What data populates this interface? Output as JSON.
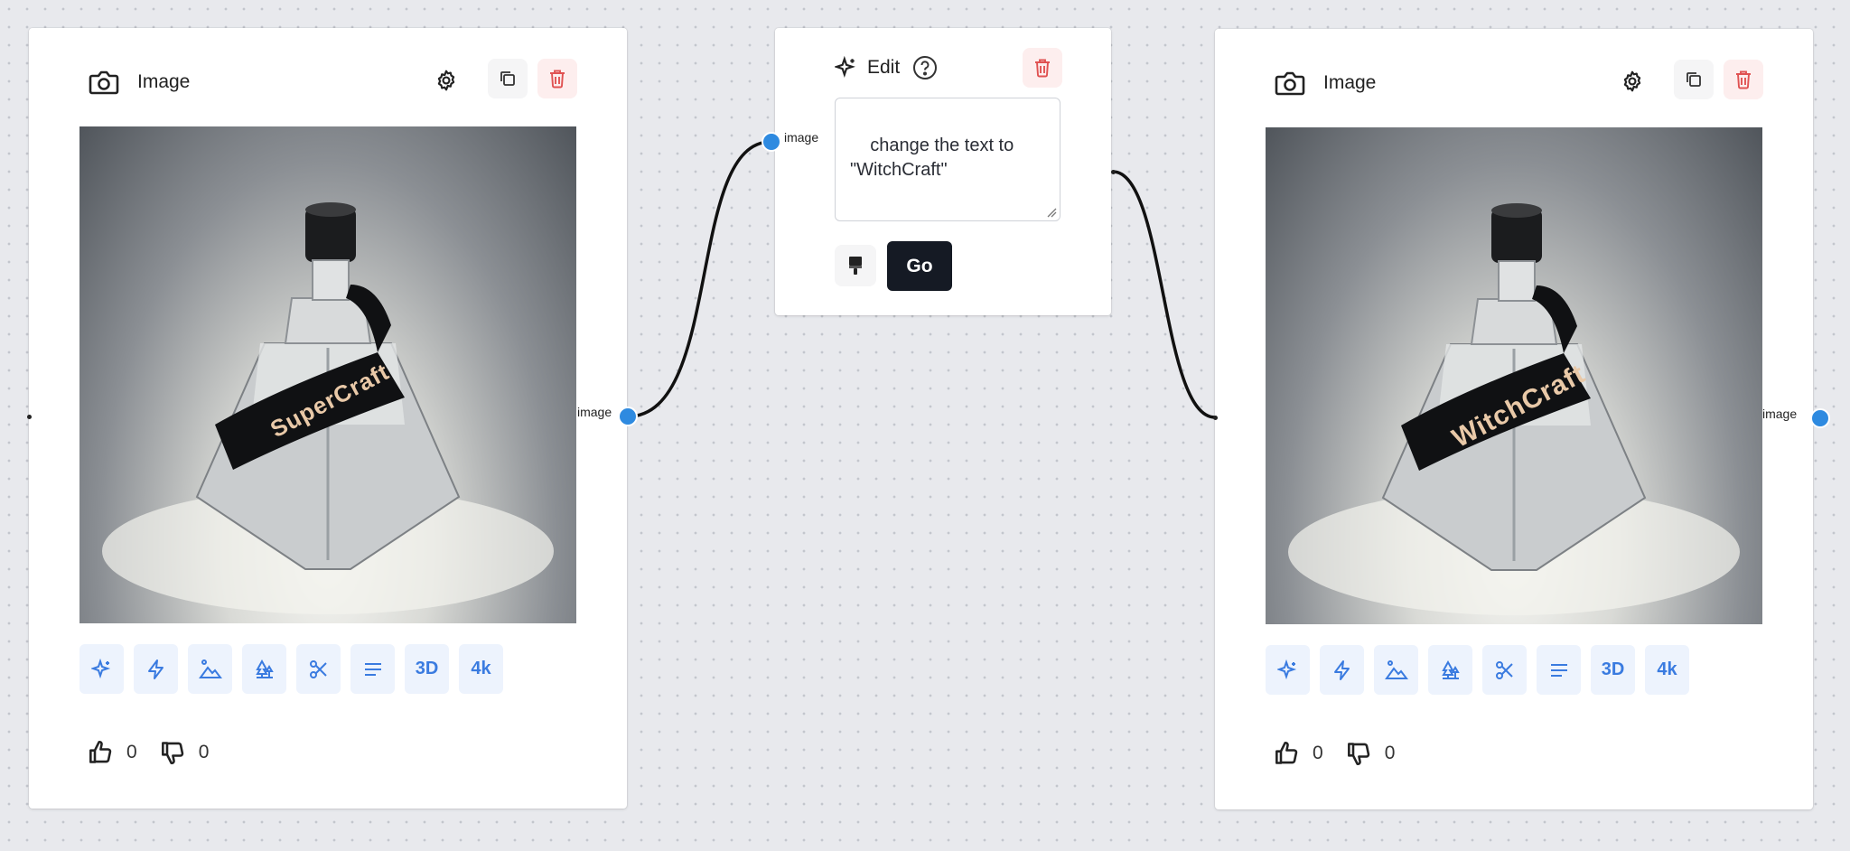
{
  "canvas": {
    "background": "#e8e9ed",
    "accent": "#3a7be0",
    "port_color": "#2e8ae0",
    "danger": "#e05252"
  },
  "left_node": {
    "title": "Image",
    "icon": "camera-icon",
    "output_port_label": "image",
    "bottle_label": "SuperCraft",
    "tools": [
      {
        "name": "magic-sparkle-tool",
        "label": ""
      },
      {
        "name": "lightning-tool",
        "label": ""
      },
      {
        "name": "landscape-tool",
        "label": ""
      },
      {
        "name": "trees-tool",
        "label": ""
      },
      {
        "name": "scissors-tool",
        "label": ""
      },
      {
        "name": "text-lines-tool",
        "label": ""
      },
      {
        "name": "3d-tool",
        "label": "3D"
      },
      {
        "name": "4k-tool",
        "label": "4k"
      }
    ],
    "likes": "0",
    "dislikes": "0"
  },
  "edit_node": {
    "title": "Edit",
    "input_port_label": "image",
    "prompt_value": "change the text to\n\"WitchCraft\"",
    "go_label": "Go"
  },
  "right_node": {
    "title": "Image",
    "icon": "camera-icon",
    "output_port_label": "image",
    "bottle_label": "WitchCraft",
    "tools": [
      {
        "name": "magic-sparkle-tool",
        "label": ""
      },
      {
        "name": "lightning-tool",
        "label": ""
      },
      {
        "name": "landscape-tool",
        "label": ""
      },
      {
        "name": "trees-tool",
        "label": ""
      },
      {
        "name": "scissors-tool",
        "label": ""
      },
      {
        "name": "text-lines-tool",
        "label": ""
      },
      {
        "name": "3d-tool",
        "label": "3D"
      },
      {
        "name": "4k-tool",
        "label": "4k"
      }
    ],
    "likes": "0",
    "dislikes": "0"
  }
}
